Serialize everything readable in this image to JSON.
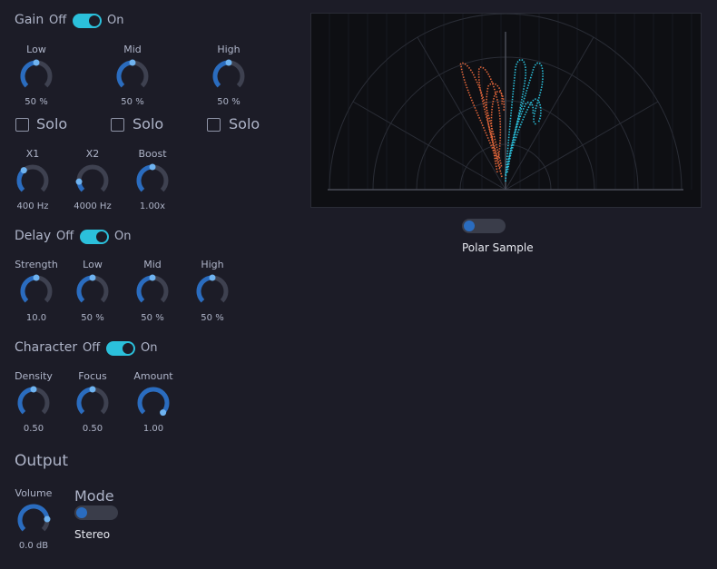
{
  "gain": {
    "title": "Gain",
    "off": "Off",
    "on": "On",
    "knobs": [
      {
        "label": "Low",
        "value": "50 %",
        "level": 0.5
      },
      {
        "label": "Mid",
        "value": "50 %",
        "level": 0.5
      },
      {
        "label": "High",
        "value": "50 %",
        "level": 0.5
      }
    ],
    "solo": [
      "Solo",
      "Solo",
      "Solo"
    ]
  },
  "crossover": {
    "knobs": [
      {
        "label": "X1",
        "value": "400 Hz",
        "level": 0.35
      },
      {
        "label": "X2",
        "value": "4000 Hz",
        "level": 0.15
      },
      {
        "label": "Boost",
        "value": "1.00x",
        "level": 0.5
      }
    ]
  },
  "delay": {
    "title": "Delay",
    "off": "Off",
    "on": "On",
    "knobs": [
      {
        "label": "Strength",
        "value": "10.0",
        "level": 0.5
      },
      {
        "label": "Low",
        "value": "50 %",
        "level": 0.5
      },
      {
        "label": "Mid",
        "value": "50 %",
        "level": 0.5
      },
      {
        "label": "High",
        "value": "50 %",
        "level": 0.5
      }
    ]
  },
  "character": {
    "title": "Character",
    "off": "Off",
    "on": "On",
    "knobs": [
      {
        "label": "Density",
        "value": "0.50",
        "level": 0.5
      },
      {
        "label": "Focus",
        "value": "0.50",
        "level": 0.5
      },
      {
        "label": "Amount",
        "value": "1.00",
        "level": 1.0
      }
    ]
  },
  "output": {
    "title": "Output",
    "volume_label": "Volume",
    "volume_value": "0.0 dB",
    "volume_level": 0.82,
    "mode_title": "Mode",
    "mode_value": "Stereo"
  },
  "polar": {
    "caption": "Polar Sample"
  },
  "colors": {
    "accent": "#2bc0db",
    "knob_arc": "#2a6cbf",
    "knob_track": "#3e4150",
    "knob_dot": "#6fb3f0",
    "trace_left": "#e0653a",
    "trace_right": "#2bc0db"
  }
}
